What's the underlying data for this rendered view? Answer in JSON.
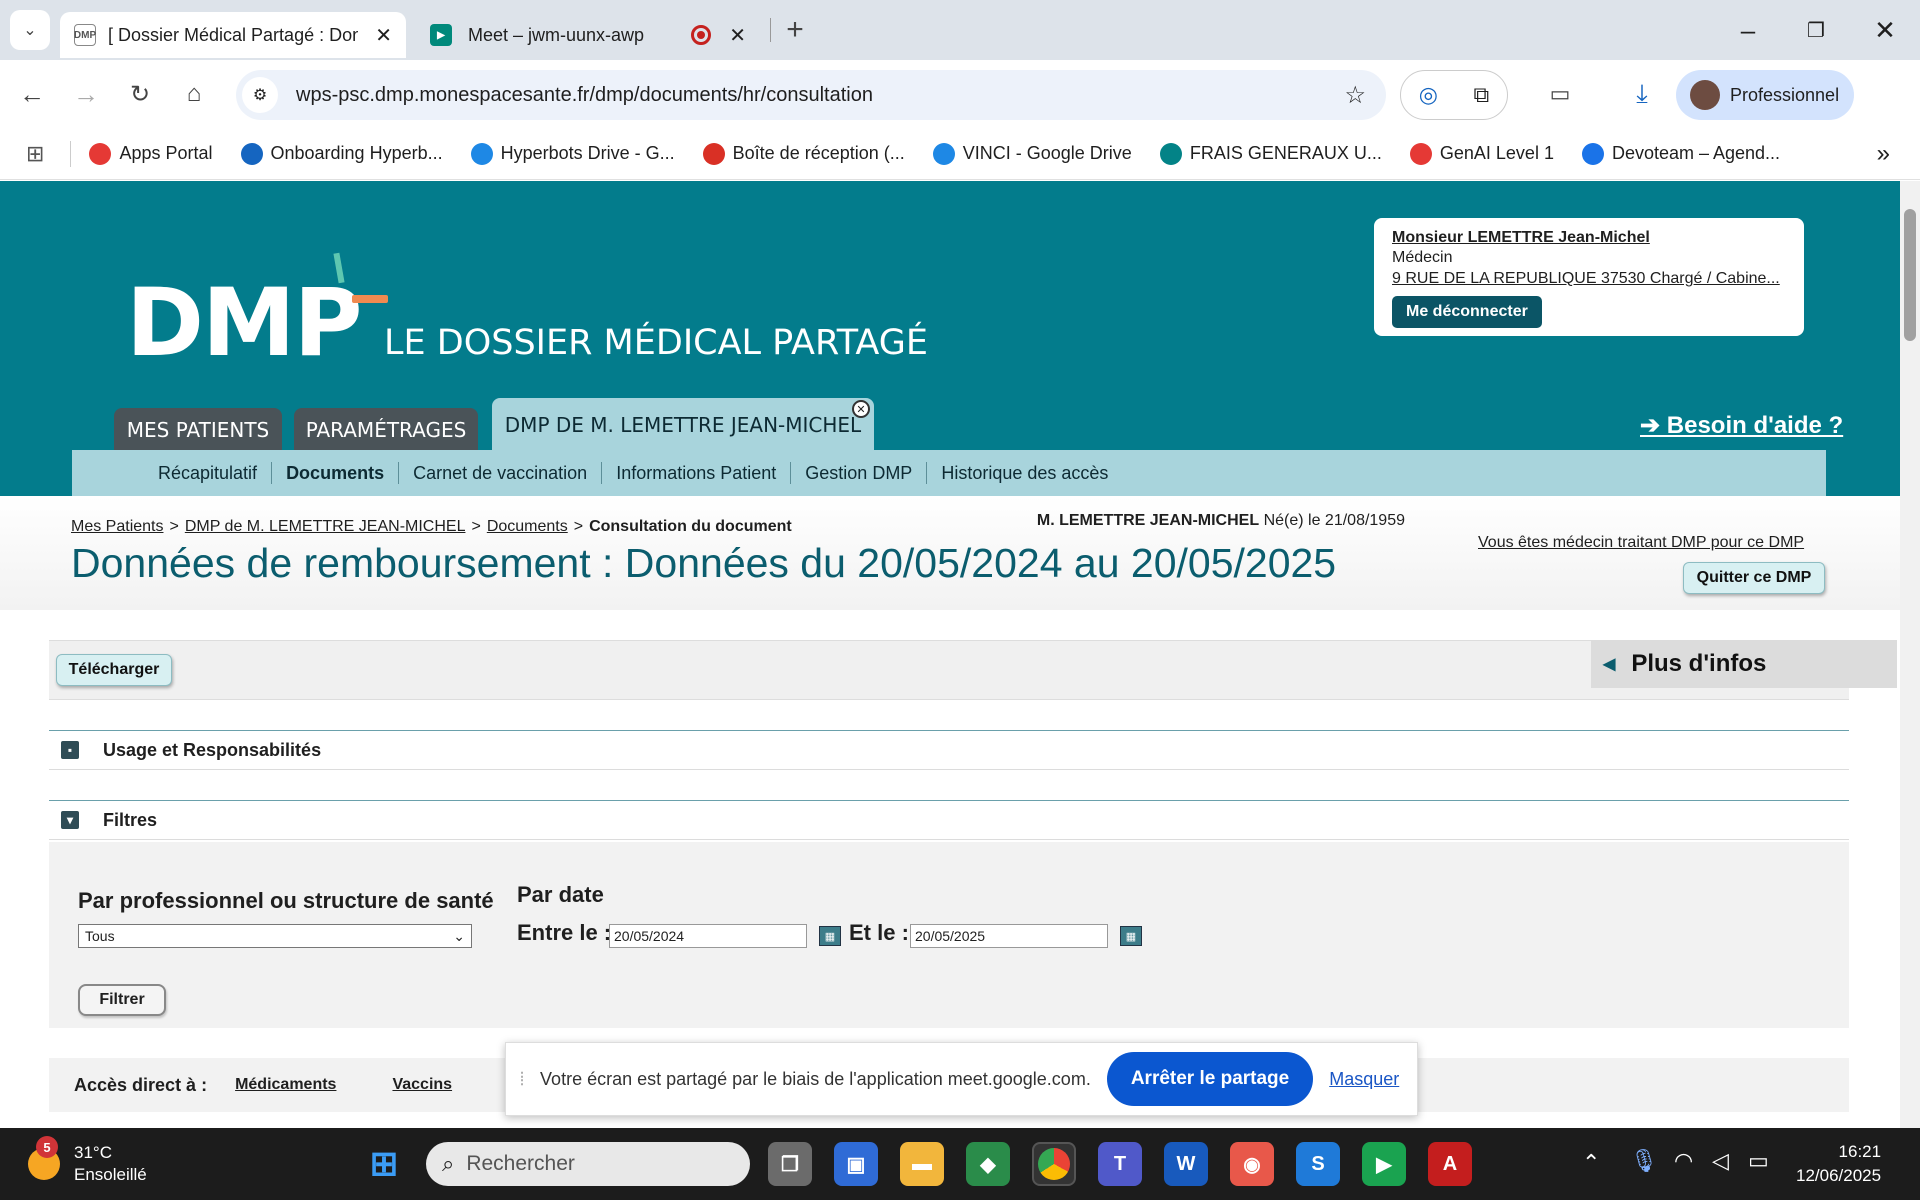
{
  "browser": {
    "tabs": [
      {
        "title": "[ Dossier Médical Partagé : Don",
        "active": true
      },
      {
        "title": "Meet – jwm-uunx-awp",
        "active": false
      }
    ],
    "url": "wps-psc.dmp.monespacesante.fr/dmp/documents/hr/consultation",
    "profile_label": "Professionnel",
    "bookmarks": [
      {
        "label": "Apps Portal",
        "icon": "apps-portal-icon",
        "color": "#e53935"
      },
      {
        "label": "Onboarding Hyperb...",
        "icon": "trello-icon",
        "color": "#1565c0"
      },
      {
        "label": "Hyperbots Drive - G...",
        "icon": "google-drive-icon",
        "color": "#1e88e5"
      },
      {
        "label": "Boîte de réception (...",
        "icon": "gmail-icon",
        "color": "#d93025"
      },
      {
        "label": "VINCI - Google Drive",
        "icon": "google-drive-icon",
        "color": "#1e88e5"
      },
      {
        "label": "FRAIS GENERAUX U...",
        "icon": "sharepoint-icon",
        "color": "#038387"
      },
      {
        "label": "GenAI Level 1",
        "icon": "genai-icon",
        "color": "#e53935"
      },
      {
        "label": "Devoteam – Agend...",
        "icon": "google-calendar-icon",
        "color": "#1a73e8"
      }
    ]
  },
  "header": {
    "logo_text": "DMP",
    "logo_subtitle": "LE DOSSIER MÉDICAL PARTAGÉ",
    "tabs": [
      "MES PATIENTS",
      "PARAMÉTRAGES",
      "DMP DE M. LEMETTRE JEAN-MICHEL"
    ],
    "help_link": "➔ Besoin d'aide ?",
    "user": {
      "name": "Monsieur LEMETTRE Jean-Michel",
      "role": "Médecin",
      "address": "9 RUE DE LA REPUBLIQUE 37530 Chargé / Cabine...",
      "logout": "Me déconnecter"
    },
    "subnav": [
      "Récapitulatif",
      "Documents",
      "Carnet de vaccination",
      "Informations Patient",
      "Gestion DMP",
      "Historique des accès"
    ]
  },
  "breadcrumb": {
    "items": [
      "Mes Patients",
      "DMP de M. LEMETTRE JEAN-MICHEL",
      "Documents"
    ],
    "separator": ">",
    "current": "Consultation du document"
  },
  "page": {
    "title": "Données de remboursement : Données du 20/05/2024 au 20/05/2025",
    "patient_name": "M. LEMETTRE JEAN-MICHEL",
    "patient_birth_label": "Né(e) le",
    "patient_birth": "21/08/1959",
    "treating_doctor": "Vous êtes médecin traitant DMP pour ce DMP",
    "quit_button": "Quitter ce DMP",
    "download_button": "Télécharger",
    "more_info": "Plus d'infos",
    "section_usage": "Usage et Responsabilités",
    "section_filters": "Filtres"
  },
  "filters": {
    "professional_label": "Par professionnel ou structure de santé",
    "professional_value": "Tous",
    "date_label": "Par date",
    "from_label": "Entre le :",
    "from_value": "20/05/2024",
    "to_label": "Et le :",
    "to_value": "20/05/2025",
    "submit": "Filtrer"
  },
  "direct_access": {
    "label": "Accès direct à :",
    "links": [
      "Médicaments",
      "Vaccins"
    ]
  },
  "share_bar": {
    "message": "Votre écran est partagé par le biais de l'application meet.google.com.",
    "stop": "Arrêter le partage",
    "hide": "Masquer"
  },
  "taskbar": {
    "weather_temp": "31°C",
    "weather_desc": "Ensoleillé",
    "weather_badge": "5",
    "search_placeholder": "Rechercher",
    "time": "16:21",
    "date": "12/06/2025"
  }
}
